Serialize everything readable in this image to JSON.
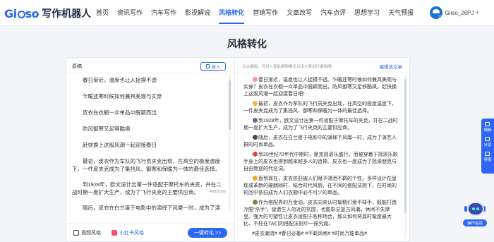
{
  "header": {
    "logo_mark": "Gi so",
    "logo_text": "写作机器人",
    "nav": [
      {
        "label": "首页",
        "active": false
      },
      {
        "label": "资讯写作",
        "active": false
      },
      {
        "label": "汽车写作",
        "active": false
      },
      {
        "label": "影视解说",
        "active": false
      },
      {
        "label": "风格转化",
        "active": true
      },
      {
        "label": "营销写作",
        "active": false
      },
      {
        "label": "文章改写",
        "active": false
      },
      {
        "label": "汽车点评",
        "active": false
      },
      {
        "label": "思想学习",
        "active": false
      },
      {
        "label": "天气预报",
        "active": false
      }
    ],
    "user_name": "Giiso_26PJ"
  },
  "page_title": "风格转化",
  "left_panel": {
    "label": "原稿",
    "import_label": "导入",
    "lines": [
      "春日渐近，温度也让人捉摸不透",
      "乍暖还寒时候如何兼具美观与实穿",
      "皮衣在衣橱一众单品中脱颖而出",
      "防风御寒又足够酷飒",
      "赶快换上这股风潮一起迎接春日",
      "最初，皮衣作为军队的飞行员夹克出现，在高空的极度温度下，一件皮夹克成为了集挡风、御寒和保暖为一体的最佳选择。",
      "到1928年，欧文设计出第一件适配于摩托车的夹克，并在二战时期一度扩大生产，成为了飞行夹克的主要供应商。",
      "随后，皮衣在白兰度于电影中的演绎下风靡一时，成为了演艺界的"
    ],
    "char_count": "468/1000",
    "style_options": [
      {
        "label": "视频风格"
      },
      {
        "label": "小红书风格"
      }
    ],
    "convert_label": "一键转化 >>"
  },
  "right_panel": {
    "hint": "点击编辑，可进入智能编辑模式对该文章进行编辑哦！",
    "edit_label": "编辑该文章",
    "paragraphs": [
      "春日渐近，温度也让人捉摸不透。乍暖还寒时候如何兼具美观与实穿？皮衣在衣橱一众单品中脱颖而出，防风御寒又足够酷飒。赶快换上这股风潮一起迎接春日吧！",
      "最初，皮衣作为军队的飞行员夹克出现，在高空的极度温度下，一件皮夹克成为了集挡风、御寒和保暖为一体的最佳选择。",
      "到1928年，欧文设计出第一件适配于摩托车的夹克，并在二战时期一度扩大生产，成为了飞行夹克的主要供应商。",
      "随后，皮衣在白兰度于电影中的演绎下风靡一时，成为了演艺人群的时尚单品。",
      "到20世纪70年代中期时，朋克摇滚乐盛行，而被穿着于摇滚乐歌手身上的皮衣也得到越来越多人的追捧。皮衣也一度成为了摇滚朋克与自由叛逆的代名词。",
      "直到现在，皮衣依旧被人们赋予潇洒不羁的个性。多样设计在呈现或革新的硬朗同时，结合时代风貌，在不同的搭配法则下，在时尚的轮回中依旧成为人们衣橱中必不可少的单品。",
      "作为搭配界的万金油，皮衣向来认时髦精们爱不释手，既能打造冷酷“杀手”，营造生人勿近的氛围，也能彰显复古风潮，休闲不失摩登。强大的可塑性让皮衣适配于各种场合，那么如何将其时髦度最大化、不枉在TA们的搭配法则中一探究竟。",
      "#皮衣潮流# #春日必备# #不羁风格# #时尚万能单品#"
    ]
  },
  "side_toolbar": [
    {
      "label": "编辑",
      "icon": "edit-icon"
    },
    {
      "label": "分享",
      "icon": "share-icon"
    },
    {
      "label": "客服",
      "icon": "support-icon"
    }
  ],
  "assistant": {
    "label": "操作指南"
  },
  "colors": {
    "accent": "#2b66f6",
    "bg": "#f3f5f9"
  }
}
